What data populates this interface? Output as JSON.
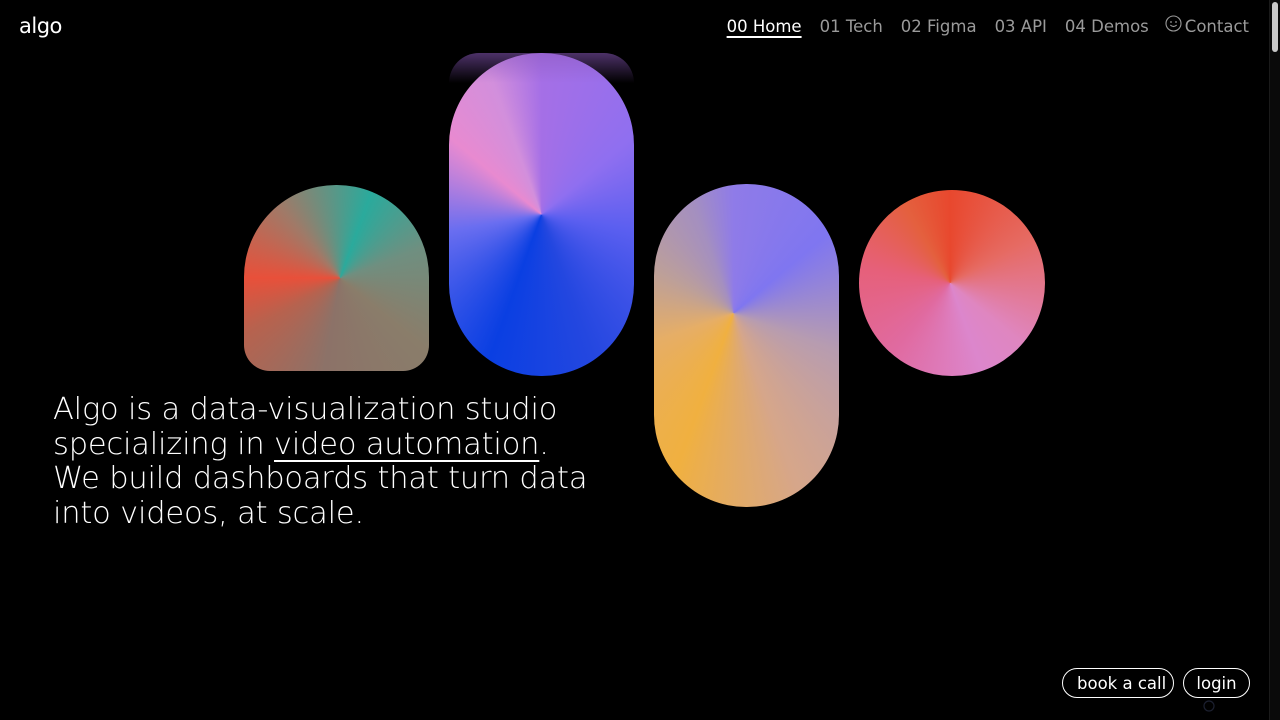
{
  "brand": {
    "logo_text": "algo"
  },
  "nav": {
    "items": [
      {
        "label": "00 Home",
        "active": true
      },
      {
        "label": "01 Tech",
        "active": false
      },
      {
        "label": "02 Figma",
        "active": false
      },
      {
        "label": "03 API",
        "active": false
      },
      {
        "label": "04 Demos",
        "active": false
      }
    ],
    "contact_label": "Contact",
    "contact_icon": "smiley-icon"
  },
  "hero": {
    "line1": "Algo is a data-visualization studio",
    "line2_before": "specializing in ",
    "line2_link": "video automation",
    "line2_after": ".",
    "line3": "We build dashboards that turn data",
    "line4": "into videos, at scale."
  },
  "shapes": [
    {
      "name": "arch",
      "colors": [
        "#2aaa9c",
        "#e8503a",
        "#8c7268"
      ]
    },
    {
      "name": "tall-pill",
      "colors": [
        "#d28fdc",
        "#0a3fe2",
        "#a56fe6"
      ]
    },
    {
      "name": "pill",
      "colors": [
        "#8f7be8",
        "#f0b040",
        "#bc9f9a"
      ]
    },
    {
      "name": "circle",
      "colors": [
        "#e8482e",
        "#dc86cc",
        "#e6607a"
      ]
    }
  ],
  "actions": {
    "book_call_label": "book a call",
    "login_label": "login"
  },
  "colors": {
    "background": "#000000",
    "text": "#ffffff",
    "nav_inactive": "#9a9a9a"
  }
}
